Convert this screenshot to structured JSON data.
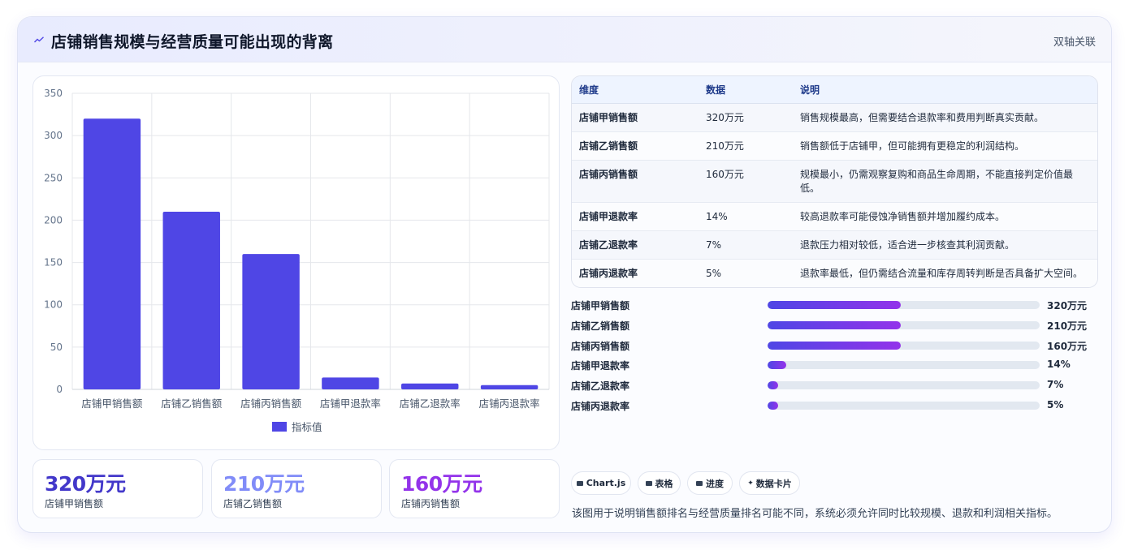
{
  "header": {
    "title": "店铺销售规模与经营质量可能出现的背离",
    "tag": "双轴关联",
    "icon": "trend-icon"
  },
  "chart_data": {
    "type": "bar",
    "categories": [
      "店铺甲销售额",
      "店铺乙销售额",
      "店铺丙销售额",
      "店铺甲退款率",
      "店铺乙退款率",
      "店铺丙退款率"
    ],
    "series": [
      {
        "name": "指标值",
        "values": [
          320,
          210,
          160,
          14,
          7,
          5
        ],
        "color": "#4f46e5"
      }
    ],
    "ylim": [
      0,
      350
    ],
    "yticks": [
      "0",
      "50",
      "100",
      "150",
      "200",
      "250",
      "300",
      "350"
    ],
    "grid": true,
    "legend": "bottom"
  },
  "stats": [
    {
      "value": "320万元",
      "label": "店铺甲销售额",
      "color": "#4338ca"
    },
    {
      "value": "210万元",
      "label": "店铺乙销售额",
      "color": "#818cf8"
    },
    {
      "value": "160万元",
      "label": "店铺丙销售额",
      "color": "#9333ea"
    }
  ],
  "table": {
    "headers": [
      "维度",
      "数据",
      "说明"
    ],
    "rows": [
      [
        "店铺甲销售额",
        "320万元",
        "销售规模最高，但需要结合退款率和费用判断真实贡献。"
      ],
      [
        "店铺乙销售额",
        "210万元",
        "销售额低于店铺甲，但可能拥有更稳定的利润结构。"
      ],
      [
        "店铺丙销售额",
        "160万元",
        "规模最小，仍需观察复购和商品生命周期，不能直接判定价值最低。"
      ],
      [
        "店铺甲退款率",
        "14%",
        "较高退款率可能侵蚀净销售额并增加履约成本。"
      ],
      [
        "店铺乙退款率",
        "7%",
        "退款压力相对较低，适合进一步核查其利润贡献。"
      ],
      [
        "店铺丙退款率",
        "5%",
        "退款率最低，但仍需结合流量和库存周转判断是否具备扩大空间。"
      ]
    ]
  },
  "progress": [
    {
      "label": "店铺甲销售额",
      "value": "320万元",
      "fill": 0.49
    },
    {
      "label": "店铺乙销售额",
      "value": "210万元",
      "fill": 0.49
    },
    {
      "label": "店铺丙销售额",
      "value": "160万元",
      "fill": 0.49
    },
    {
      "label": "店铺甲退款率",
      "value": "14%",
      "fill": 0.07
    },
    {
      "label": "店铺乙退款率",
      "value": "7%",
      "fill": 0.04
    },
    {
      "label": "店铺丙退款率",
      "value": "5%",
      "fill": 0.04
    }
  ],
  "chips": [
    {
      "label": "Chart.js",
      "icon": "chart-icon"
    },
    {
      "label": "表格",
      "icon": "table-icon"
    },
    {
      "label": "进度",
      "icon": "progress-icon"
    },
    {
      "label": "数据卡片",
      "icon": "sparkle-icon"
    }
  ],
  "chip_glyphs": {
    "sparkle": "✦"
  },
  "footnote": "该图用于说明销售额排名与经营质量排名可能不同，系统必须允许同时比较规模、退款和利润相关指标。"
}
